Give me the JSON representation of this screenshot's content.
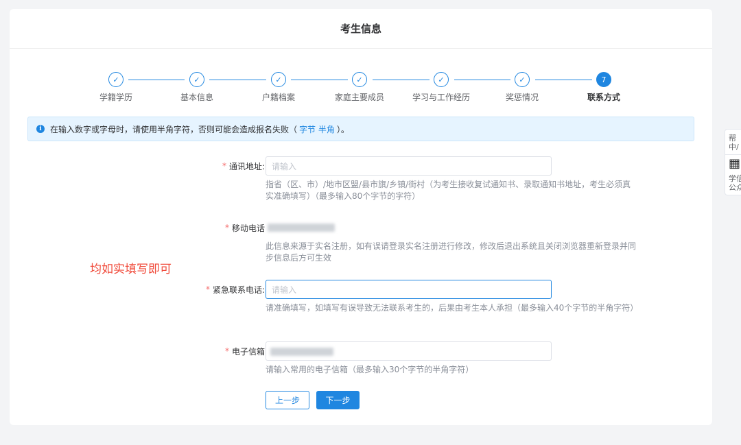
{
  "header": {
    "title": "考生信息"
  },
  "steps": [
    {
      "label": "学籍学历",
      "mark": "✓"
    },
    {
      "label": "基本信息",
      "mark": "✓"
    },
    {
      "label": "户籍档案",
      "mark": "✓"
    },
    {
      "label": "家庭主要成员",
      "mark": "✓"
    },
    {
      "label": "学习与工作经历",
      "mark": "✓"
    },
    {
      "label": "奖惩情况",
      "mark": "✓"
    },
    {
      "label": "联系方式",
      "mark": "7"
    }
  ],
  "notice": {
    "icon": "info-icon",
    "text_before": "在输入数字或字母时，请使用半角字符，否则可能会造成报名失败（",
    "link": "字节 半角",
    "text_after": "）。"
  },
  "form": {
    "address": {
      "required": "*",
      "label": "通讯地址:",
      "placeholder": "请输入",
      "hint": "指省（区、市）/地市区盟/县市旗/乡镇/街村（为考生接收复试通知书、录取通知书地址，考生必须真实准确填写）（最多输入80个字节的字符）"
    },
    "mobile": {
      "required": "*",
      "label": "移动电话",
      "hint": "此信息来源于实名注册，如有误请登录实名注册进行修改，修改后退出系统且关闭浏览器重新登录并同步信息后方可生效"
    },
    "emergency": {
      "required": "*",
      "label": "紧急联系电话:",
      "placeholder": "请输入",
      "hint": "请准确填写，如填写有误导致无法联系考生的，后果由考生本人承担（最多输入40个字节的半角字符）"
    },
    "email": {
      "required": "*",
      "label": "电子信箱",
      "hint": "请输入常用的电子信箱（最多输入30个字节的半角字符）"
    }
  },
  "buttons": {
    "prev": "上一步",
    "next": "下一步"
  },
  "annotation": "均如实填写即可",
  "side": {
    "help_top": "帮",
    "help_bottom": "中/",
    "wx_top": "学信",
    "wx_bottom": "公众"
  }
}
